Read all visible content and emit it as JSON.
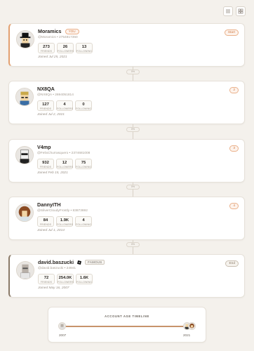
{
  "toolbar": {
    "list_icon": "list-icon",
    "grid_icon": "grid-icon"
  },
  "accounts": [
    {
      "name": "Moramics",
      "you": "YOU",
      "handle": "@Moramics • 2754817350",
      "pill": "Start",
      "stats": [
        {
          "num": "273",
          "lbl": "FRIENDS"
        },
        {
          "num": "26",
          "lbl": "FOLLOWERS"
        },
        {
          "num": "13",
          "lbl": "FOLLOWING"
        }
      ],
      "joined": "Joined Jul 25, 2021"
    },
    {
      "name": "NX8QA",
      "handle": "@NX8QA • 2694051814",
      "pill": "2",
      "stats": [
        {
          "num": "127",
          "lbl": "FRIENDS"
        },
        {
          "num": "4",
          "lbl": "FOLLOWERS"
        },
        {
          "num": "0",
          "lbl": "FOLLOWING"
        }
      ],
      "joined": "Joined Jul 2, 2021"
    },
    {
      "name": "V4mp",
      "handle": "@FelixChurrasquero • 2374681008",
      "pill": "3",
      "stats": [
        {
          "num": "932",
          "lbl": "FRIENDS"
        },
        {
          "num": "12",
          "lbl": "FOLLOWERS"
        },
        {
          "num": "75",
          "lbl": "FOLLOWING"
        }
      ],
      "joined": "Joined Feb 15, 2021"
    },
    {
      "name": "DannyITH",
      "handle": "@SilverCloudyFrostly • 83873692",
      "pill": "4",
      "stats": [
        {
          "num": "84",
          "lbl": "FRIENDS"
        },
        {
          "num": "1.9K",
          "lbl": "FOLLOWERS"
        },
        {
          "num": "4",
          "lbl": "FOLLOWING"
        }
      ],
      "joined": "Joined Jul 1, 2014"
    },
    {
      "name": "david.baszucki",
      "tag": "FAMOUS",
      "handle": "@david.baszucki • 24941",
      "pill": "End",
      "stats": [
        {
          "num": "72",
          "lbl": "FRIENDS"
        },
        {
          "num": "254.0K",
          "lbl": "FOLLOWERS"
        },
        {
          "num": "1.6K",
          "lbl": "FOLLOWING"
        }
      ],
      "joined": "Joined May 16, 2007"
    }
  ],
  "gaps": [
    "0%",
    "0%",
    "0%",
    "0%"
  ],
  "timeline": {
    "title": "ACCOUNT AGE TIMELINE",
    "start_year": "2007",
    "end_year": "2021"
  },
  "colors": {
    "accent": "#d07a45",
    "timeline_line": "#c7936b",
    "background": "#f4f1ec"
  }
}
